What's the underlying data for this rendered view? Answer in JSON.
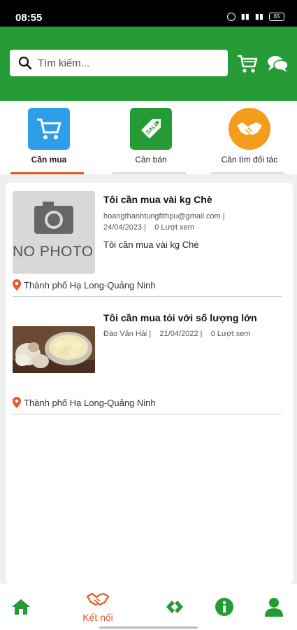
{
  "status_bar": {
    "time": "08:55",
    "battery": "65"
  },
  "header": {
    "search_placeholder": "Tìm kiếm...",
    "icons": [
      "search-icon",
      "cart-icon",
      "chat-icon"
    ]
  },
  "categories": [
    {
      "label": "Cần mua",
      "icon": "cart-icon",
      "color": "#2f9ee8",
      "active": true
    },
    {
      "label": "Cần bán",
      "icon": "sale-tag-icon",
      "color": "#259b35",
      "active": false
    },
    {
      "label": "Cần tìm đối tác",
      "icon": "handshake-icon",
      "color": "#f29d1c",
      "active": false
    }
  ],
  "listings": [
    {
      "title": "Tôi cần mua vài kg Chè",
      "meta_line1": "hoangthanhtungfithpu@gmail.com |",
      "meta_line2": "24/04/2023 |    0 Lượt xem",
      "description": "Tôi cần mua vài kg Chè",
      "location": "Thành phố Hạ Long-Quảng Ninh",
      "image_text": "NO PHOTO"
    },
    {
      "title": "Tôi cần mua tỏi với số lượng lớn",
      "meta_line1": "Đào Văn Hải |    21/04/2022 |    0 Lượt xem",
      "location": "Thành phố Hạ Long-Quảng Ninh",
      "image": "garlic-photo"
    }
  ],
  "bottom_nav": {
    "items": [
      "home-icon",
      "handshake-icon",
      "link-icon",
      "info-icon",
      "user-icon"
    ],
    "active_label": "Kết nối"
  },
  "colors": {
    "primary_green": "#259b35",
    "accent_orange": "#e8562a"
  }
}
